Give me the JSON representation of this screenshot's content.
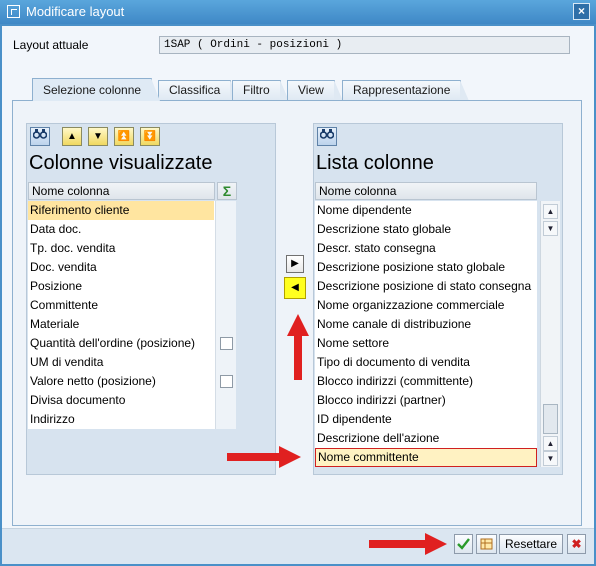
{
  "window": {
    "title": "Modificare layout"
  },
  "layout": {
    "label": "Layout attuale",
    "value": "1SAP ( Ordini - posizioni )"
  },
  "tabs": [
    {
      "label": "Selezione colonne",
      "active": true
    },
    {
      "label": "Classifica",
      "active": false
    },
    {
      "label": "Filtro",
      "active": false
    },
    {
      "label": "View",
      "active": false
    },
    {
      "label": "Rappresentazione",
      "active": false
    }
  ],
  "left_panel": {
    "title": "Colonne visualizzate",
    "header": "Nome colonna",
    "rows": [
      "Riferimento cliente",
      "Data doc.",
      "Tp. doc. vendita",
      "Doc. vendita",
      "Posizione",
      "Committente",
      "Materiale",
      "Quantità dell'ordine (posizione)",
      "UM di vendita",
      "Valore netto (posizione)",
      "Divisa documento",
      "Indirizzo"
    ],
    "selected_row": 0,
    "checkbox_rows": [
      7,
      9
    ]
  },
  "right_panel": {
    "title": "Lista colonne",
    "header": "Nome colonna",
    "rows": [
      "Nome dipendente",
      "Descrizione stato globale",
      "Descr. stato consegna",
      "Descrizione posizione stato globale",
      "Descrizione posizione di stato consegna",
      "Nome organizzazione commerciale",
      "Nome canale di distribuzione",
      "Nome settore",
      "Tipo di documento di vendita",
      "Blocco indirizzi (committente)",
      "Blocco indirizzi (partner)",
      "ID dipendente",
      "Descrizione dell'azione",
      "Nome committente"
    ],
    "marked_row": 13
  },
  "footer": {
    "reset_label": "Resettare"
  },
  "colors": {
    "accent": "#ffe5a0",
    "highlight": "#ffff20",
    "arrow": "#e02020"
  }
}
